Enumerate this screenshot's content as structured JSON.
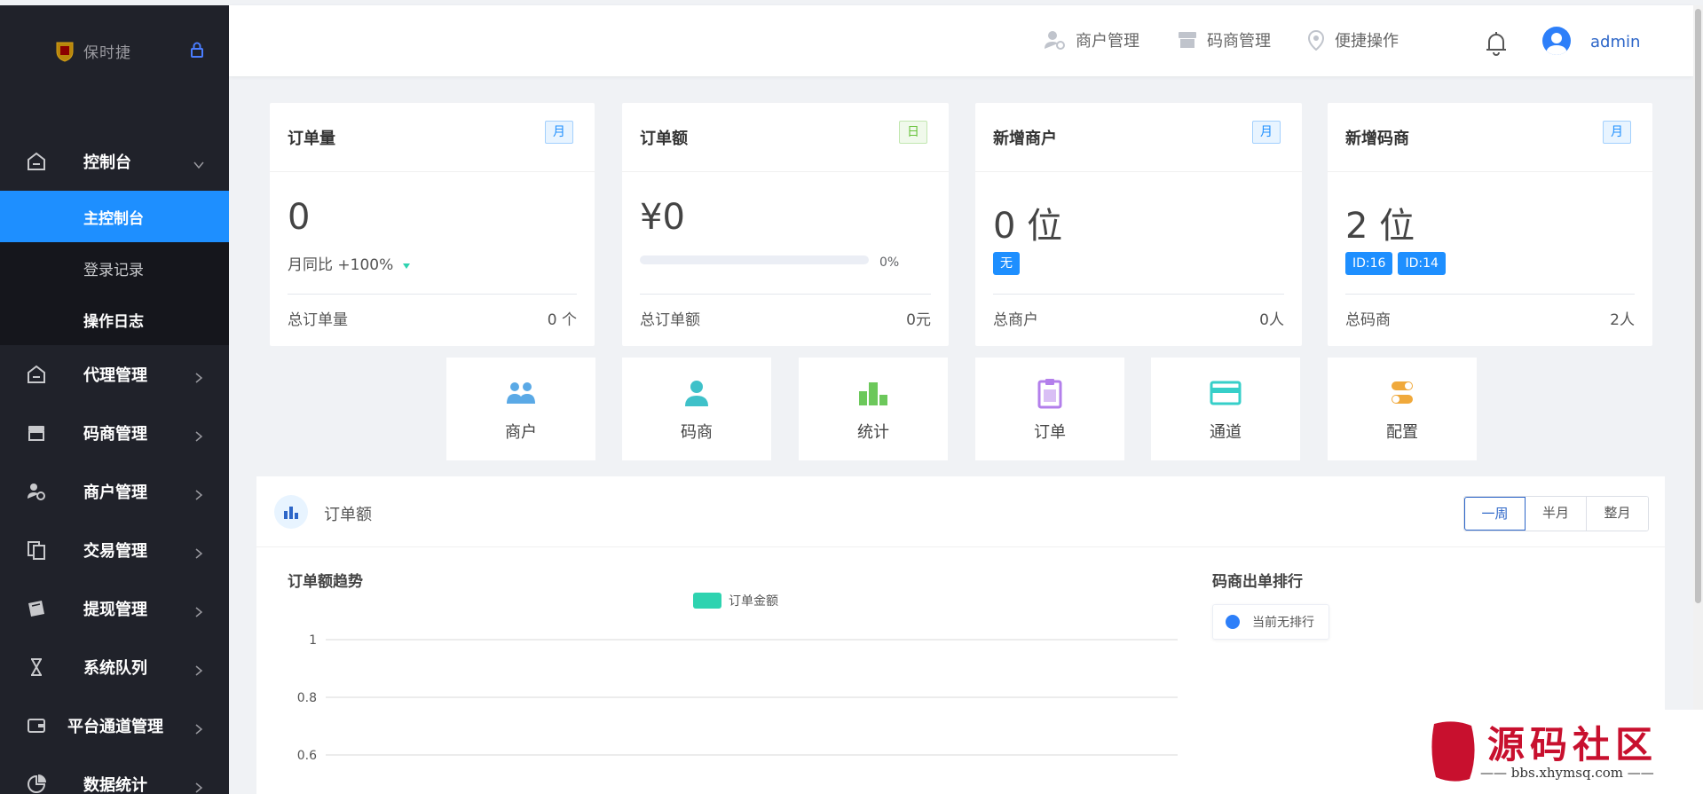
{
  "sidebar": {
    "logo_text": "保时捷",
    "groups": [
      {
        "label": "控制台",
        "icon": "dashboard-icon",
        "expanded": true,
        "children": [
          {
            "label": "主控制台",
            "active": true
          },
          {
            "label": "登录记录",
            "active": false
          },
          {
            "label": "操作日志",
            "active": false
          }
        ]
      }
    ],
    "items": [
      {
        "label": "代理管理",
        "icon": "house-icon"
      },
      {
        "label": "码商管理",
        "icon": "store-icon"
      },
      {
        "label": "商户管理",
        "icon": "user-gear-icon"
      },
      {
        "label": "交易管理",
        "icon": "documents-icon"
      },
      {
        "label": "提现管理",
        "icon": "wallet-icon"
      },
      {
        "label": "系统队列",
        "icon": "hourglass-icon"
      },
      {
        "label": "平台通道管理",
        "icon": "card-icon"
      },
      {
        "label": "数据统计",
        "icon": "pie-chart-icon"
      }
    ]
  },
  "topbar": {
    "links": [
      {
        "label": "商户管理",
        "icon": "user-gear-icon"
      },
      {
        "label": "码商管理",
        "icon": "store-icon"
      },
      {
        "label": "便捷操作",
        "icon": "location-pin-icon"
      }
    ],
    "username": "admin"
  },
  "stats": {
    "orders": {
      "title": "订单量",
      "tag": "月",
      "value": "0",
      "sub": "月同比 +100%",
      "foot_label": "总订单量",
      "foot_value": "0 个"
    },
    "amount": {
      "title": "订单额",
      "tag": "日",
      "value": "¥0",
      "progress_percent": 0,
      "progress_text": "0%",
      "foot_label": "总订单额",
      "foot_value": "0元"
    },
    "merchants": {
      "title": "新增商户",
      "tag": "月",
      "value": "0 位",
      "badges": [
        "无"
      ],
      "foot_label": "总商户",
      "foot_value": "0人"
    },
    "coders": {
      "title": "新增码商",
      "tag": "月",
      "value": "2 位",
      "badges": [
        "ID:16",
        "ID:14"
      ],
      "foot_label": "总码商",
      "foot_value": "2人"
    }
  },
  "shortcuts": [
    {
      "label": "商户",
      "icon": "users-icon",
      "color": "#5aa9e6"
    },
    {
      "label": "码商",
      "icon": "user-icon",
      "color": "#3fc1c9"
    },
    {
      "label": "统计",
      "icon": "bar-chart-icon",
      "color": "#6cc85b"
    },
    {
      "label": "订单",
      "icon": "clipboard-icon",
      "color": "#b37feb"
    },
    {
      "label": "通道",
      "icon": "card-icon",
      "color": "#36cfc9"
    },
    {
      "label": "配置",
      "icon": "toggle-icon",
      "color": "#f0a93b"
    }
  ],
  "panel": {
    "title": "订单额",
    "range_buttons": [
      {
        "label": "一周",
        "active": true
      },
      {
        "label": "半月",
        "active": false
      },
      {
        "label": "整月",
        "active": false
      }
    ],
    "rank_title": "码商出单排行",
    "rank_empty": "当前无排行"
  },
  "chart_data": {
    "type": "line",
    "title": "订单额趋势",
    "series": [
      {
        "name": "订单金额",
        "values": []
      }
    ],
    "y_ticks": [
      "1",
      "0.8",
      "0.6"
    ],
    "ylim": [
      0.6,
      1
    ],
    "grid": true,
    "legend": "top-center",
    "colors": {
      "series": "#2ed3b0"
    }
  },
  "watermark": {
    "seal_text": "小猿",
    "text": "源码社区",
    "url": "—— bbs.xhymsq.com ——"
  },
  "colors": {
    "primary": "#1e8fff",
    "sidebar_bg": "#20222a",
    "accent_link": "#2d66c8"
  }
}
